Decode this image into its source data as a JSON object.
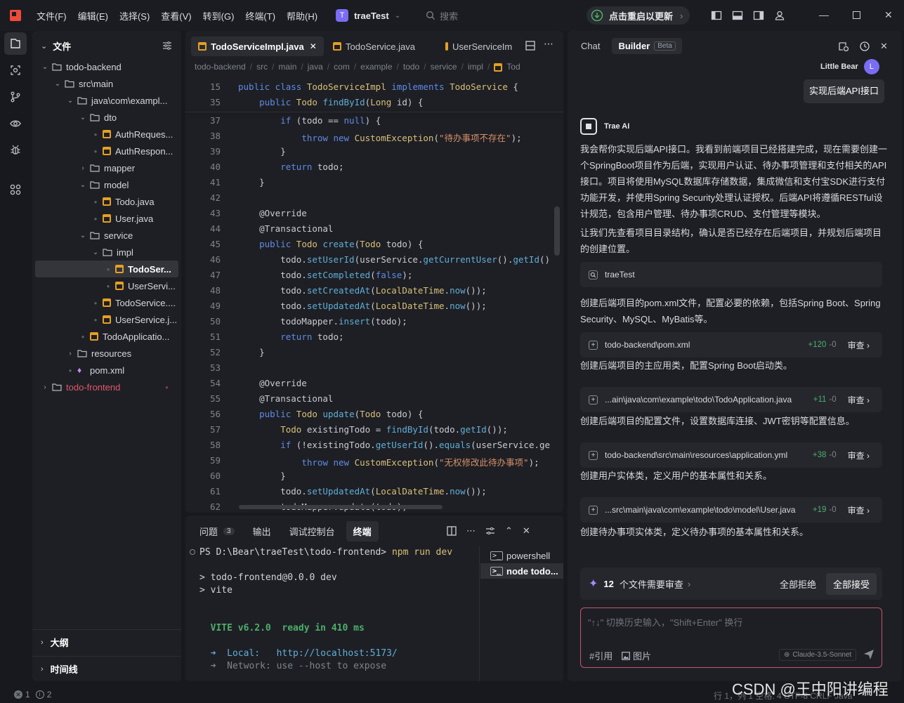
{
  "titlebar": {
    "menus": [
      "文件(F)",
      "编辑(E)",
      "选择(S)",
      "查看(V)",
      "转到(G)",
      "终端(T)",
      "帮助(H)"
    ],
    "project_avatar": "T",
    "project_name": "traeTest",
    "search_placeholder": "搜索",
    "restart_label": "点击重启以更新"
  },
  "explorer": {
    "title": "文件",
    "rows": [
      {
        "label": "todo-backend",
        "kind": "folder",
        "open": true,
        "depth": 0
      },
      {
        "label": "src\\main",
        "kind": "folder",
        "open": true,
        "depth": 1
      },
      {
        "label": "java\\com\\exampl...",
        "kind": "folder",
        "open": true,
        "depth": 2
      },
      {
        "label": "dto",
        "kind": "folder",
        "open": true,
        "depth": 3
      },
      {
        "label": "AuthReques...",
        "kind": "java",
        "depth": 4
      },
      {
        "label": "AuthRespon...",
        "kind": "java",
        "depth": 4
      },
      {
        "label": "mapper",
        "kind": "folder",
        "open": false,
        "depth": 3
      },
      {
        "label": "model",
        "kind": "folder",
        "open": true,
        "depth": 3
      },
      {
        "label": "Todo.java",
        "kind": "java",
        "depth": 4
      },
      {
        "label": "User.java",
        "kind": "java",
        "depth": 4
      },
      {
        "label": "service",
        "kind": "folder",
        "open": true,
        "depth": 3
      },
      {
        "label": "impl",
        "kind": "folder",
        "open": true,
        "depth": 4
      },
      {
        "label": "TodoSer...",
        "kind": "java",
        "depth": 5,
        "selected": true
      },
      {
        "label": "UserServi...",
        "kind": "java",
        "depth": 5
      },
      {
        "label": "TodoService....",
        "kind": "java",
        "depth": 4
      },
      {
        "label": "UserService.j...",
        "kind": "java",
        "depth": 4
      },
      {
        "label": "TodoApplicatio...",
        "kind": "java",
        "depth": 3
      },
      {
        "label": "resources",
        "kind": "folder",
        "open": false,
        "depth": 2
      },
      {
        "label": "pom.xml",
        "kind": "xml",
        "depth": 2
      },
      {
        "label": "todo-frontend",
        "kind": "folder",
        "open": false,
        "depth": 0,
        "red": true
      }
    ],
    "outline_label": "大纲",
    "timeline_label": "时间线"
  },
  "editor": {
    "tabs": [
      "TodoServiceImpl.java",
      "TodoService.java",
      "UserServiceIm"
    ],
    "breadcrumb": [
      "todo-backend",
      "src",
      "main",
      "java",
      "com",
      "example",
      "todo",
      "service",
      "impl",
      "Tod"
    ],
    "lines": [
      {
        "n": "15",
        "code": [
          [
            "kw",
            "public class "
          ],
          [
            "ty",
            "TodoServiceImpl "
          ],
          [
            "kw",
            "implements "
          ],
          [
            "ty",
            "TodoService"
          ],
          [
            "va",
            " {"
          ]
        ]
      },
      {
        "n": "35",
        "code": [
          [
            "va",
            "    "
          ],
          [
            "kw",
            "public "
          ],
          [
            "ty",
            "Todo "
          ],
          [
            "fn",
            "findById"
          ],
          [
            "va",
            "("
          ],
          [
            "ty",
            "Long "
          ],
          [
            "va",
            "id) {"
          ]
        ]
      },
      {
        "n": "37",
        "code": [
          [
            "va",
            "        "
          ],
          [
            "kw",
            "if "
          ],
          [
            "va",
            "(todo == "
          ],
          [
            "kw",
            "null"
          ],
          [
            "va",
            ") {"
          ]
        ]
      },
      {
        "n": "38",
        "code": [
          [
            "va",
            "            "
          ],
          [
            "kw",
            "throw new "
          ],
          [
            "ty",
            "CustomException"
          ],
          [
            "va",
            "("
          ],
          [
            "st",
            "\"待办事项不存在\""
          ],
          [
            "va",
            ");"
          ]
        ]
      },
      {
        "n": "39",
        "code": [
          [
            "va",
            "        }"
          ]
        ]
      },
      {
        "n": "40",
        "code": [
          [
            "va",
            "        "
          ],
          [
            "kw",
            "return "
          ],
          [
            "va",
            "todo;"
          ]
        ]
      },
      {
        "n": "41",
        "code": [
          [
            "va",
            "    }"
          ]
        ]
      },
      {
        "n": "42",
        "code": [
          [
            "va",
            ""
          ]
        ]
      },
      {
        "n": "43",
        "code": [
          [
            "an",
            "    @Override"
          ]
        ]
      },
      {
        "n": "44",
        "code": [
          [
            "an",
            "    @Transactional"
          ]
        ]
      },
      {
        "n": "45",
        "code": [
          [
            "va",
            "    "
          ],
          [
            "kw",
            "public "
          ],
          [
            "ty",
            "Todo "
          ],
          [
            "fn",
            "create"
          ],
          [
            "va",
            "("
          ],
          [
            "ty",
            "Todo "
          ],
          [
            "va",
            "todo) {"
          ]
        ]
      },
      {
        "n": "46",
        "code": [
          [
            "va",
            "        todo."
          ],
          [
            "fn",
            "setUserId"
          ],
          [
            "va",
            "(userService."
          ],
          [
            "fn",
            "getCurrentUser"
          ],
          [
            "va",
            "()."
          ],
          [
            "fn",
            "getId"
          ],
          [
            "va",
            "()"
          ]
        ]
      },
      {
        "n": "47",
        "code": [
          [
            "va",
            "        todo."
          ],
          [
            "fn",
            "setCompleted"
          ],
          [
            "va",
            "("
          ],
          [
            "kw",
            "false"
          ],
          [
            "va",
            ");"
          ]
        ]
      },
      {
        "n": "48",
        "code": [
          [
            "va",
            "        todo."
          ],
          [
            "fn",
            "setCreatedAt"
          ],
          [
            "va",
            "("
          ],
          [
            "ty",
            "LocalDateTime"
          ],
          [
            "va",
            "."
          ],
          [
            "fn",
            "now"
          ],
          [
            "va",
            "());"
          ]
        ]
      },
      {
        "n": "49",
        "code": [
          [
            "va",
            "        todo."
          ],
          [
            "fn",
            "setUpdatedAt"
          ],
          [
            "va",
            "("
          ],
          [
            "ty",
            "LocalDateTime"
          ],
          [
            "va",
            "."
          ],
          [
            "fn",
            "now"
          ],
          [
            "va",
            "());"
          ]
        ]
      },
      {
        "n": "50",
        "code": [
          [
            "va",
            "        todoMapper."
          ],
          [
            "fn",
            "insert"
          ],
          [
            "va",
            "(todo);"
          ]
        ]
      },
      {
        "n": "51",
        "code": [
          [
            "va",
            "        "
          ],
          [
            "kw",
            "return "
          ],
          [
            "va",
            "todo;"
          ]
        ]
      },
      {
        "n": "52",
        "code": [
          [
            "va",
            "    }"
          ]
        ]
      },
      {
        "n": "53",
        "code": [
          [
            "va",
            ""
          ]
        ]
      },
      {
        "n": "54",
        "code": [
          [
            "an",
            "    @Override"
          ]
        ]
      },
      {
        "n": "55",
        "code": [
          [
            "an",
            "    @Transactional"
          ]
        ]
      },
      {
        "n": "56",
        "code": [
          [
            "va",
            "    "
          ],
          [
            "kw",
            "public "
          ],
          [
            "ty",
            "Todo "
          ],
          [
            "fn",
            "update"
          ],
          [
            "va",
            "("
          ],
          [
            "ty",
            "Todo "
          ],
          [
            "va",
            "todo) {"
          ]
        ]
      },
      {
        "n": "57",
        "code": [
          [
            "va",
            "        "
          ],
          [
            "ty",
            "Todo "
          ],
          [
            "va",
            "existingTodo = "
          ],
          [
            "fn",
            "findById"
          ],
          [
            "va",
            "(todo."
          ],
          [
            "fn",
            "getId"
          ],
          [
            "va",
            "());"
          ]
        ]
      },
      {
        "n": "58",
        "code": [
          [
            "va",
            "        "
          ],
          [
            "kw",
            "if "
          ],
          [
            "va",
            "(!existingTodo."
          ],
          [
            "fn",
            "getUserId"
          ],
          [
            "va",
            "()."
          ],
          [
            "fn",
            "equals"
          ],
          [
            "va",
            "(userService.ge"
          ]
        ]
      },
      {
        "n": "59",
        "code": [
          [
            "va",
            "            "
          ],
          [
            "kw",
            "throw new "
          ],
          [
            "ty",
            "CustomException"
          ],
          [
            "va",
            "("
          ],
          [
            "st",
            "\"无权修改此待办事项\""
          ],
          [
            "va",
            ");"
          ]
        ]
      },
      {
        "n": "60",
        "code": [
          [
            "va",
            "        }"
          ]
        ]
      },
      {
        "n": "61",
        "code": [
          [
            "va",
            "        todo."
          ],
          [
            "fn",
            "setUpdatedAt"
          ],
          [
            "va",
            "("
          ],
          [
            "ty",
            "LocalDateTime"
          ],
          [
            "va",
            "."
          ],
          [
            "fn",
            "now"
          ],
          [
            "va",
            "());"
          ]
        ]
      },
      {
        "n": "62",
        "code": [
          [
            "va",
            "        todoMapper.update(todo);"
          ]
        ]
      }
    ]
  },
  "terminal": {
    "tabs": [
      {
        "label": "问题",
        "badge": "3"
      },
      {
        "label": "输出"
      },
      {
        "label": "调试控制台"
      },
      {
        "label": "终端",
        "active": true
      }
    ],
    "lines": [
      {
        "t": "PS D:\\Bear\\traeTest\\todo-frontend> ",
        "cmd": "npm run dev"
      },
      {
        "t": ""
      },
      {
        "t": "> todo-frontend@0.0.0 dev"
      },
      {
        "t": "> vite"
      },
      {
        "t": ""
      },
      {
        "t": ""
      },
      {
        "t": "  VITE v6.2.0  ready in 410 ms",
        "vite": true
      },
      {
        "t": ""
      },
      {
        "t": "  ➜  Local:   http://localhost:5173/",
        "local": true
      },
      {
        "t": "  ➜  Network: use --host to expose",
        "network": true
      }
    ],
    "sessions": [
      {
        "label": "powershell"
      },
      {
        "label": "node  todo...",
        "active": true
      }
    ]
  },
  "chat": {
    "tabs": {
      "chat": "Chat",
      "builder": "Builder",
      "beta": "Beta"
    },
    "user_name": "Little Bear",
    "user_avatar": "L",
    "user_message": "实现后端API接口",
    "ai_name": "Trae AI",
    "ai_intro": "我会帮你实现后端API接口。我看到前端项目已经搭建完成，现在需要创建一个SpringBoot项目作为后端，实现用户认证、待办事项管理和支付相关的API接口。项目将使用MySQL数据库存储数据，集成微信和支付宝SDK进行支付功能开发，并使用Spring Security处理认证授权。后端API将遵循RESTful设计规范，包含用户管理、待办事项CRUD、支付管理等模块。",
    "ai_check": "让我们先查看项目目录结构，确认是否已经存在后端项目，并规划后端项目的创建位置。",
    "search_card": "traeTest",
    "steps": [
      {
        "text": "创建后端项目的pom.xml文件，配置必要的依赖，包括Spring Boot、Spring Security、MySQL、MyBatis等。",
        "file": "todo-backend\\pom.xml",
        "added": "+120",
        "removed": "-0"
      },
      {
        "text": "创建后端项目的主应用类，配置Spring Boot启动类。",
        "file": "...ain\\java\\com\\example\\todo\\TodoApplication.java",
        "added": "+11",
        "removed": "-0"
      },
      {
        "text": "创建后端项目的配置文件，设置数据库连接、JWT密钥等配置信息。",
        "file": "todo-backend\\src\\main\\resources\\application.yml",
        "added": "+38",
        "removed": "-0"
      },
      {
        "text": "创建用户实体类，定义用户的基本属性和关系。",
        "file": "...src\\main\\java\\com\\example\\todo\\model\\User.java",
        "added": "+19",
        "removed": "-0"
      },
      {
        "text": "创建待办事项实体类，定义待办事项的基本属性和关系。"
      }
    ],
    "review_label": "审查",
    "pending_count": "12",
    "pending_text": "个文件需要审查",
    "reject_all": "全部拒绝",
    "accept_all": "全部接受",
    "input_placeholder": "\"↑↓\" 切换历史输入，\"Shift+Enter\" 换行",
    "ref_label": "#引用",
    "image_label": "图片",
    "model": "Claude-3.5-Sonnet"
  },
  "status": {
    "errors": "1",
    "warnings": "2",
    "right": "行 1，列 1   空格: 4   UTF-8   CRLF   Java",
    "watermark": "CSDN @王中阳讲编程"
  },
  "colors": {
    "accent": "#7b6cf6",
    "java": "#e5a022",
    "green": "#4caf6a",
    "vite": "#4caf6a"
  }
}
